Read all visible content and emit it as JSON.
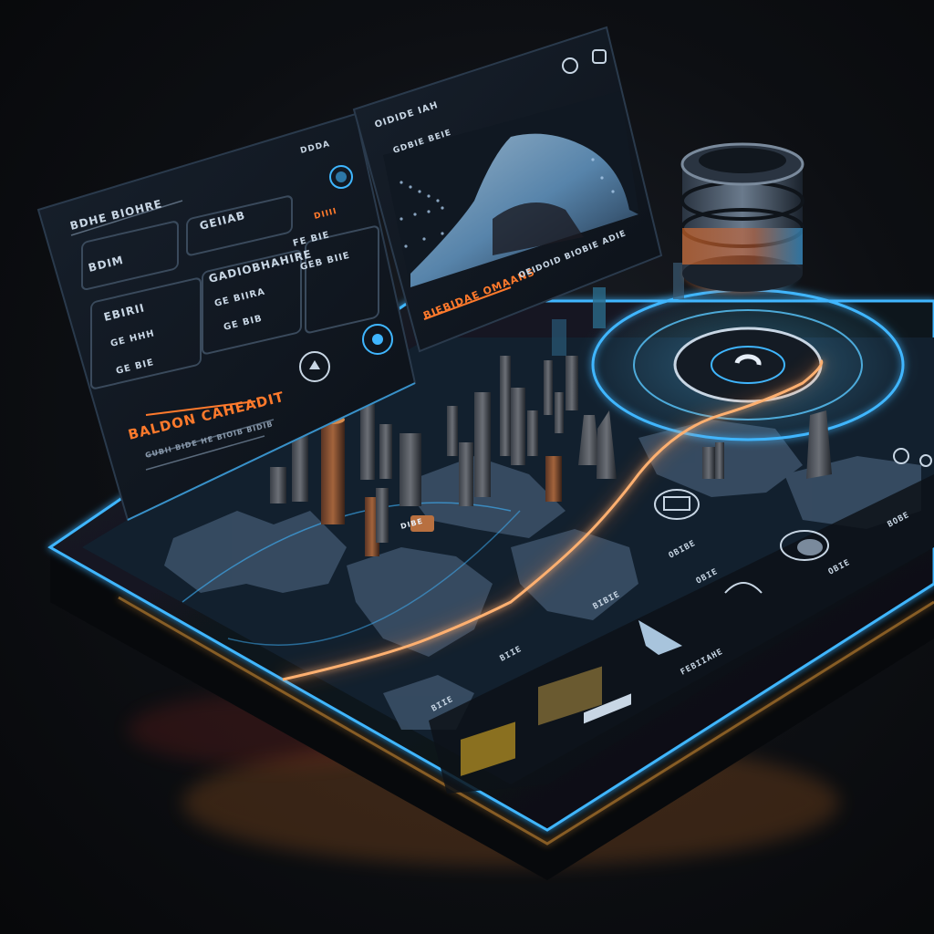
{
  "left_panel": {
    "header": "BDHE BIOHRE",
    "field_1": "BDIM",
    "field_2": "GEIIAB",
    "field_2_lines": [
      "GE HHH",
      "GE BIE"
    ],
    "card_1": "EBIRII",
    "card_2": "GADIOBHAHIRE",
    "card_2_lines": [
      "GE BIIRA",
      "GE BIB"
    ],
    "side_rows": [
      "FE BIE",
      "GEB BIIE"
    ],
    "top_tags": [
      "DDDA",
      "DIIII"
    ],
    "alert_title": "BALDON CAHEADIT",
    "alert_subtitle": "GUBII BIDE HE BIOIB BIDIB"
  },
  "right_panel": {
    "header": "OIDIDE IAH",
    "subheader": "GDBIE BEIE",
    "caption_left": "BIEBIDAE OMAANS",
    "caption_right": "OEIDOID BIOBIE ADIE"
  },
  "map_labels": {
    "billboard": "DIBE",
    "menu_1": "OBIBE",
    "menu_2": "OBIE",
    "menu_3": "BIBIE",
    "menu_4": "FEBIIAHE",
    "menu_5": "BIIE",
    "menu_6": "OBIE",
    "menu_7": "BOBE",
    "menu_8": "BIIE"
  },
  "colors": {
    "accent_blue": "#3fb6ff",
    "accent_orange": "#ff7a2c",
    "panel_bg": "#0f1620",
    "map_land": "#3a4f66"
  },
  "icons": [
    "user-icon",
    "search-icon",
    "gear-icon",
    "target-icon",
    "navigation-arrow-icon",
    "camera-icon",
    "power-icon",
    "headphone-icon"
  ]
}
